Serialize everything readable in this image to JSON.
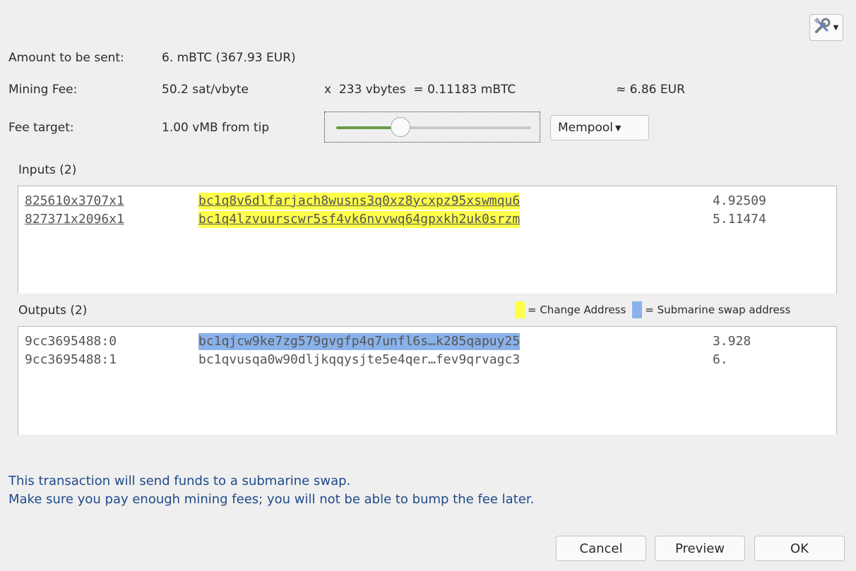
{
  "header": {
    "tools_icon": "tools-icon",
    "dropdown_icon": "chevron-down-icon"
  },
  "summary": {
    "amount_label": "Amount to be sent:",
    "amount_value": "6. mBTC (367.93 EUR)",
    "fee_label": "Mining Fee:",
    "fee_rate": "50.2 sat/vbyte",
    "fee_calc": "x  233 vbytes  = 0.11183 mBTC",
    "fee_fiat": "≈ 6.86 EUR",
    "target_label": "Fee target:",
    "target_value": "1.00 vMB from tip",
    "slider_level": 0.33,
    "fee_method": "Mempool"
  },
  "inputs": {
    "title": "Inputs (2)",
    "rows": [
      {
        "outpoint": "825610x3707x1",
        "address": "bc1q8v6dlfarjach8wusns3q0xz8ycxpz95xswmqu6",
        "amount": "4.92509"
      },
      {
        "outpoint": "827371x2096x1",
        "address": "bc1q4lzvuurscwr5sf4vk6nvvwq64gpxkh2uk0srzm",
        "amount": "5.11474"
      }
    ]
  },
  "outputs": {
    "title": "Outputs (2)",
    "rows": [
      {
        "outpoint": "9cc3695488:0",
        "address": "bc1qjcw9ke7zg579gvgfp4q7unfl6s…k285qapuy25",
        "amount": "3.928"
      },
      {
        "outpoint": "9cc3695488:1",
        "address": "bc1qvusqa0w90dljkqqysjte5e4qer…fev9qrvagc3",
        "amount": "6."
      }
    ]
  },
  "legend": {
    "change": "= Change Address",
    "swap": "= Submarine swap address",
    "change_color": "#ffff4a",
    "swap_color": "#8ab2ea"
  },
  "warning": {
    "line1": "This transaction will send funds to a submarine swap.",
    "line2": "Make sure you pay enough mining fees; you will not be able to bump the fee later."
  },
  "buttons": {
    "cancel": "Cancel",
    "preview": "Preview",
    "ok": "OK"
  }
}
